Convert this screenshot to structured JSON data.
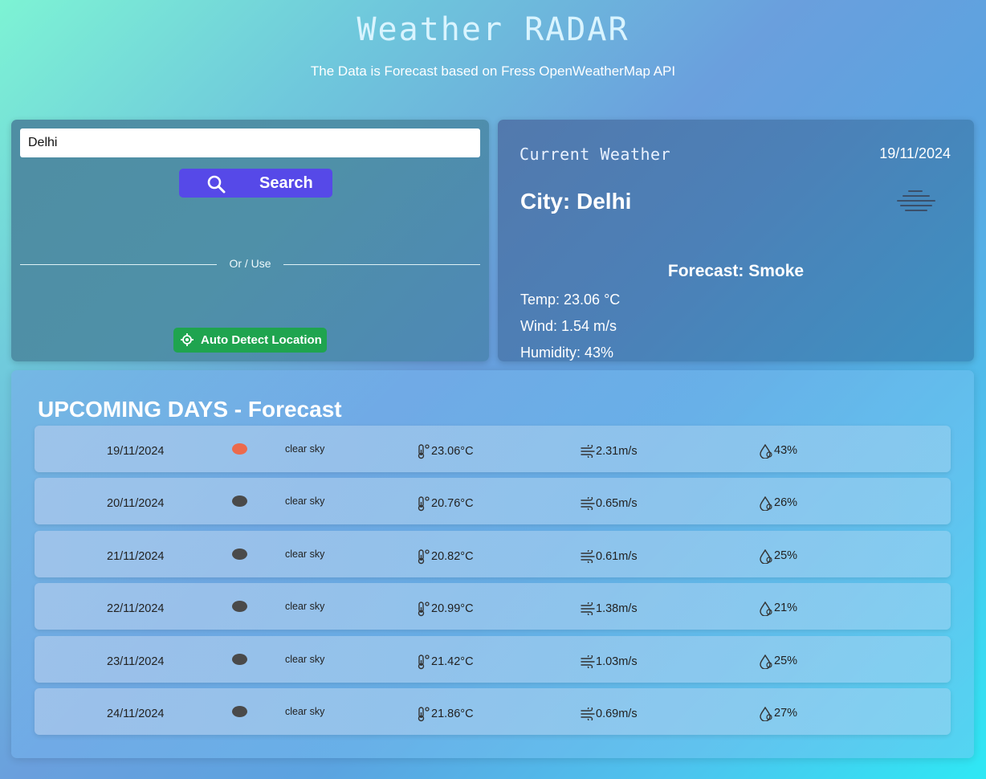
{
  "header": {
    "title": "Weather RADAR",
    "subtitle": "The Data is Forecast based on Fress OpenWeatherMap API"
  },
  "search": {
    "value": "Delhi",
    "button_label": "Search",
    "divider_text": "Or / Use",
    "auto_detect_label": "Auto Detect Location"
  },
  "current": {
    "heading": "Current Weather",
    "date": "19/11/2024",
    "city": "City: Delhi",
    "forecast": "Forecast: Smoke",
    "temp": "Temp: 23.06 °C",
    "wind": "Wind: 1.54 m/s",
    "humidity": "Humidity: 43%",
    "icon": "smoke-icon"
  },
  "forecast": {
    "title": "UPCOMING DAYS - Forecast",
    "rows": [
      {
        "date": "19/11/2024",
        "desc": "clear sky",
        "temp": "23.06°C",
        "wind": "2.31m/s",
        "humidity": "43%",
        "icon": "sun-dot"
      },
      {
        "date": "20/11/2024",
        "desc": "clear sky",
        "temp": "20.76°C",
        "wind": "0.65m/s",
        "humidity": "26%",
        "icon": "moon-dot"
      },
      {
        "date": "21/11/2024",
        "desc": "clear sky",
        "temp": "20.82°C",
        "wind": "0.61m/s",
        "humidity": "25%",
        "icon": "moon-dot"
      },
      {
        "date": "22/11/2024",
        "desc": "clear sky",
        "temp": "20.99°C",
        "wind": "1.38m/s",
        "humidity": "21%",
        "icon": "moon-dot"
      },
      {
        "date": "23/11/2024",
        "desc": "clear sky",
        "temp": "21.42°C",
        "wind": "1.03m/s",
        "humidity": "25%",
        "icon": "moon-dot"
      },
      {
        "date": "24/11/2024",
        "desc": "clear sky",
        "temp": "21.86°C",
        "wind": "0.69m/s",
        "humidity": "27%",
        "icon": "moon-dot"
      }
    ]
  },
  "colors": {
    "search_button": "#5649e8",
    "auto_detect_button": "#1fa44f",
    "sun_dot": "#ec6a4c",
    "night_dot": "#4a4a4a"
  }
}
